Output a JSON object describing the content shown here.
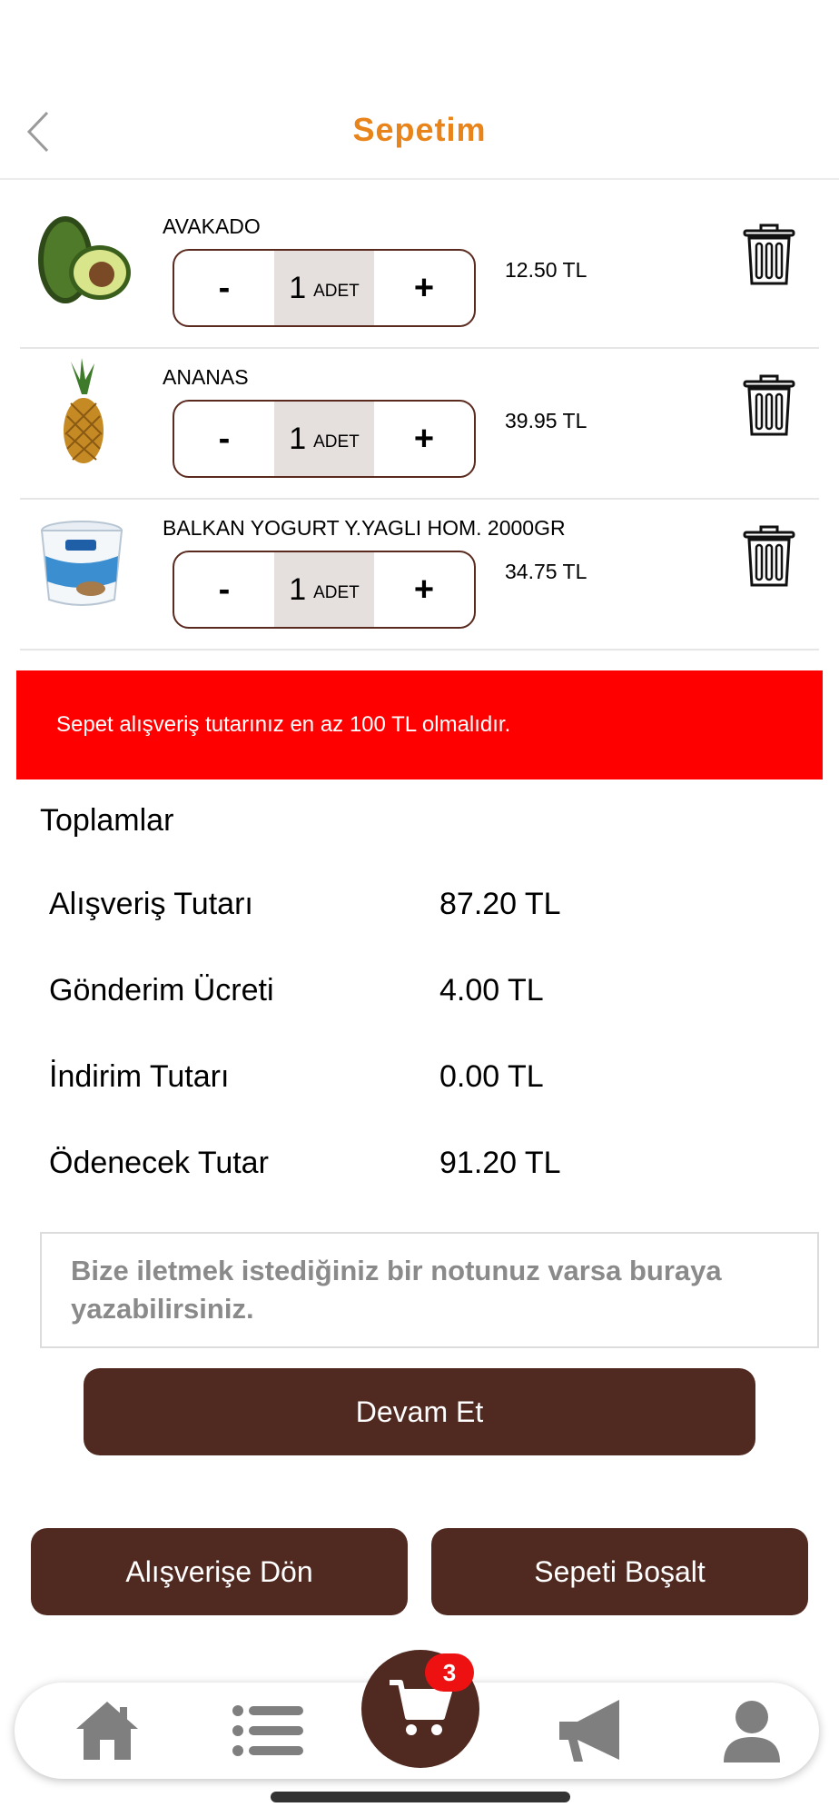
{
  "header": {
    "title": "Sepetim",
    "back_icon": "chevron-left-icon"
  },
  "colors": {
    "accent_orange": "#e8841a",
    "brown": "#502a21",
    "warning_red": "#ff0000",
    "badge_red": "#ee1111",
    "icon_gray": "#7f7f7f"
  },
  "cart": {
    "items": [
      {
        "name": "AVAKADO",
        "qty": "1",
        "unit": "ADET",
        "minus": "-",
        "plus": "+",
        "price": "12.50 TL",
        "image": "avocado-image"
      },
      {
        "name": "ANANAS",
        "qty": "1",
        "unit": "ADET",
        "minus": "-",
        "plus": "+",
        "price": "39.95 TL",
        "image": "pineapple-image"
      },
      {
        "name": "BALKAN YOGURT Y.YAGLI HOM. 2000GR",
        "qty": "1",
        "unit": "ADET",
        "minus": "-",
        "plus": "+",
        "price": "34.75 TL",
        "image": "yogurt-image"
      }
    ]
  },
  "warning": {
    "text": "Sepet alışveriş tutarınız en az 100 TL olmalıdır."
  },
  "totals": {
    "title": "Toplamlar",
    "rows": [
      {
        "label": "Alışveriş Tutarı",
        "value": "87.20 TL"
      },
      {
        "label": "Gönderim Ücreti",
        "value": "4.00 TL"
      },
      {
        "label": "İndirim Tutarı",
        "value": "0.00 TL"
      },
      {
        "label": "Ödenecek Tutar",
        "value": "91.20 TL"
      }
    ]
  },
  "note": {
    "placeholder": "Bize iletmek istediğiniz bir notunuz varsa buraya yazabilirsiniz."
  },
  "buttons": {
    "continue": "Devam Et",
    "back_to_shop": "Alışverişe Dön",
    "empty_cart": "Sepeti Boşalt"
  },
  "tabbar": {
    "items": [
      "home-icon",
      "list-icon",
      "cart-icon",
      "megaphone-icon",
      "user-icon"
    ],
    "cart_count": "3"
  }
}
